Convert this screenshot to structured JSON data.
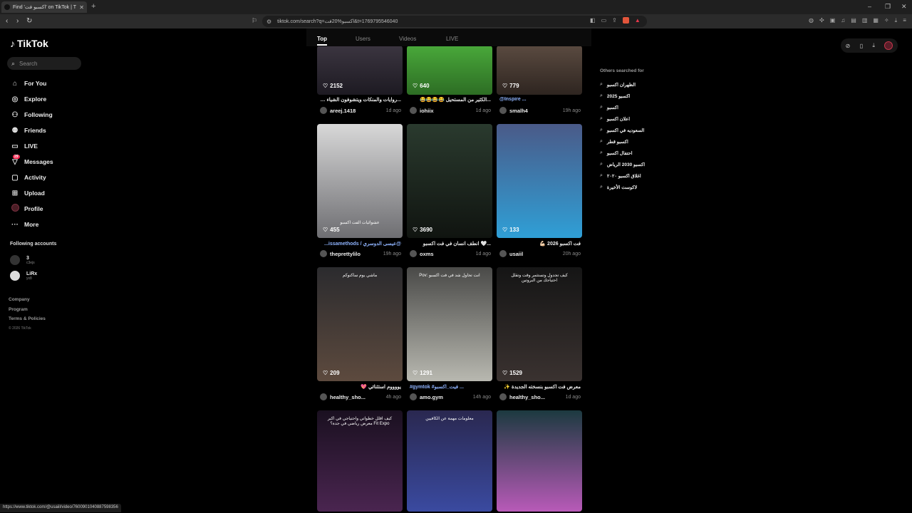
{
  "browser": {
    "tab_title": "Find 'اكسبو فت' on TikTok | TikTok",
    "url": "tiktok.com/search?q=اكسبو%20فت&t=1769795546040",
    "new_tab": "+",
    "statusbar_url": "https://www.tiktok.com/@usaiil/video/7600901040887598356"
  },
  "sidebar": {
    "logo": "TikTok",
    "search_placeholder": "Search",
    "items": [
      {
        "label": "For You",
        "icon": "home-icon"
      },
      {
        "label": "Explore",
        "icon": "compass-icon"
      },
      {
        "label": "Following",
        "icon": "user-icon"
      },
      {
        "label": "Friends",
        "icon": "friends-icon"
      },
      {
        "label": "LIVE",
        "icon": "live-icon"
      },
      {
        "label": "Messages",
        "icon": "messages-icon",
        "badge": "29"
      },
      {
        "label": "Activity",
        "icon": "activity-icon"
      },
      {
        "label": "Upload",
        "icon": "upload-icon"
      },
      {
        "label": "Profile",
        "icon": "profile-icon"
      },
      {
        "label": "More",
        "icon": "more-icon"
      }
    ],
    "following_title": "Following accounts",
    "accounts": [
      {
        "name": "3",
        "sub": "c3ejs"
      },
      {
        "name": "LiRx",
        "sub": "yx8"
      }
    ],
    "footer": [
      "Company",
      "Program",
      "Terms & Policies"
    ],
    "copyright": "© 2026 TikTok"
  },
  "tabs": [
    "Top",
    "Users",
    "Videos",
    "LIVE"
  ],
  "videos": [
    {
      "likes": "2152",
      "desc": "...روايات والمنكات ويتشوفون الشياء رهيبه",
      "user": "areej.1418",
      "time": "1d ago",
      "link": false
    },
    {
      "likes": "640",
      "desc": "...الكثير من المستحيل 😂😂😂😂",
      "user": "iohiix",
      "time": "1d ago",
      "link": false
    },
    {
      "likes": "779",
      "desc": "@Inspire ...",
      "user": "smalh4",
      "time": "19h ago",
      "link": true
    },
    {
      "likes": "455",
      "desc": "@عيسى الدوسري / issamethods...",
      "user": "theprettylilo",
      "time": "19h ago",
      "link": true
    },
    {
      "likes": "3690",
      "desc": "...🤍 انطف انسان في فت اكسبو",
      "user": "oxms",
      "time": "1d ago",
      "link": false
    },
    {
      "likes": "133",
      "desc": "فت اكسبو 2026 💪🏻",
      "user": "usaiil",
      "time": "20h ago",
      "link": false
    },
    {
      "likes": "209",
      "desc": "يووووم استثنائي 💖",
      "user": "healthy_sho...",
      "time": "4h ago",
      "link": false
    },
    {
      "likes": "1291",
      "desc": "#gymtok #فيت_اكسبو ...",
      "user": "amo.gym",
      "time": "14h ago",
      "link": true
    },
    {
      "likes": "1529",
      "desc": "معرض فت اكسبو بنسخته الجديدة ✨",
      "user": "healthy_sho...",
      "time": "1d ago",
      "link": false
    },
    {
      "likes": "",
      "desc": "",
      "user": "",
      "time": "",
      "link": false
    },
    {
      "likes": "",
      "desc": "",
      "user": "",
      "time": "",
      "link": false
    },
    {
      "likes": "",
      "desc": "",
      "user": "",
      "time": "",
      "link": false
    }
  ],
  "thumb_text": {
    "v4": "عشوائيات الفت اكسبو",
    "v7": "ماشي يوم ساكنوكم",
    "v8": "Pov: انت تحاول شد في فت اكسبو",
    "v9": "كيف تجدول وتستثمر وقت وتقلل احتياجك من البروتين",
    "v10": "كيف اقلل خطواتي واحتياجي في اكبر معرض رياضي في جدة؟ Fit Expo",
    "v11": "معلومات مهمة عن الكافيين"
  },
  "others": {
    "title": "Others searched for",
    "items": [
      "الظهران اكسبو",
      "اكسبو 2025",
      "اكسبو",
      "اعلان اكسبو",
      "السعوديه في اكسبو",
      "اكسبو قطر",
      "احتفال اكسبو",
      "اكسبو 2030 الرياض",
      "اغلاق اكسبو ٢٠٢٠",
      "لاكوست الأخيرة"
    ]
  },
  "colors": {
    "accent": "#fe2c55",
    "link": "#8fb4ff",
    "background": "#000000"
  }
}
